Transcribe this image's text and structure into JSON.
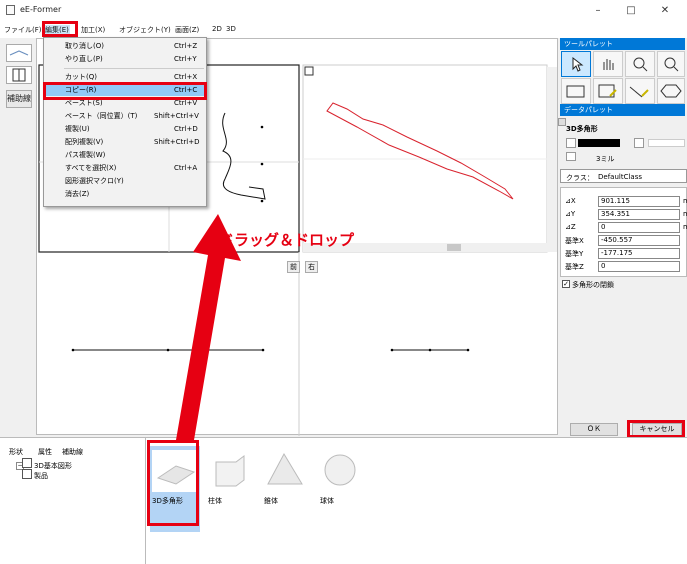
{
  "window": {
    "title": "eE-Former",
    "minimize": "–",
    "maximize": "□",
    "close": "✕"
  },
  "menubar": [
    {
      "label": "ファイル(F)"
    },
    {
      "label": "編集(E)"
    },
    {
      "label": "加工(X)"
    },
    {
      "label": "オブジェクト(Y)"
    },
    {
      "label": "画面(Z)"
    },
    {
      "label": "2D"
    },
    {
      "label": "3D"
    }
  ],
  "left_tools": {
    "aux_label": "補助線"
  },
  "edit_menu": [
    {
      "label": "取り消し(O)",
      "shortcut": "Ctrl+Z"
    },
    {
      "label": "やり直し(P)",
      "shortcut": "Ctrl+Y"
    },
    {
      "label": "カット(Q)",
      "shortcut": "Ctrl+X"
    },
    {
      "label": "コピー(R)",
      "shortcut": "Ctrl+C"
    },
    {
      "label": "ペースト(S)",
      "shortcut": "Ctrl+V"
    },
    {
      "label": "ペースト（同位置）(T)",
      "shortcut": "Shift+Ctrl+V"
    },
    {
      "label": "複製(U)",
      "shortcut": "Ctrl+D"
    },
    {
      "label": "配列複製(V)",
      "shortcut": "Shift+Ctrl+D"
    },
    {
      "label": "パス複製(W)",
      "shortcut": ""
    },
    {
      "label": "すべてを選択(X)",
      "shortcut": "Ctrl+A"
    },
    {
      "label": "図形選択マクロ(Y)",
      "shortcut": ""
    },
    {
      "label": "消去(Z)",
      "shortcut": ""
    }
  ],
  "view_labels": {
    "front": "前",
    "right": "右"
  },
  "annotation": "ドラッグ＆ドロップ",
  "tool_palette": {
    "title": "ツールパレット"
  },
  "data_palette": {
    "title": "データパレット",
    "object_name": "3D多角形",
    "line_width": "3ミル",
    "class_label": "クラス：",
    "class_value": "DefaultClass",
    "fields": [
      {
        "label": "⊿X",
        "value": "901.115",
        "unit": "mm"
      },
      {
        "label": "⊿Y",
        "value": "354.351",
        "unit": "mm"
      },
      {
        "label": "⊿Z",
        "value": "0",
        "unit": "mm"
      },
      {
        "label": "基準X",
        "value": "-450.557",
        "unit": ""
      },
      {
        "label": "基準Y",
        "value": "-177.175",
        "unit": ""
      },
      {
        "label": "基準Z",
        "value": "0",
        "unit": ""
      }
    ],
    "closed_polygon": "多角形の閉鎖",
    "ok": "ＯＫ",
    "cancel": "キャンセル"
  },
  "bottom_tabs": [
    {
      "label": "形状"
    },
    {
      "label": "属性"
    },
    {
      "label": "補助線"
    }
  ],
  "tree": [
    {
      "label": "3D基本図形"
    },
    {
      "label": "製品"
    }
  ],
  "shapes": [
    {
      "label": "3D多角形"
    },
    {
      "label": "柱体"
    },
    {
      "label": "錐体"
    },
    {
      "label": "球体"
    }
  ],
  "colors": {
    "accent": "#0078d7",
    "highlight": "#e60012",
    "selection": "#91c9f7"
  }
}
